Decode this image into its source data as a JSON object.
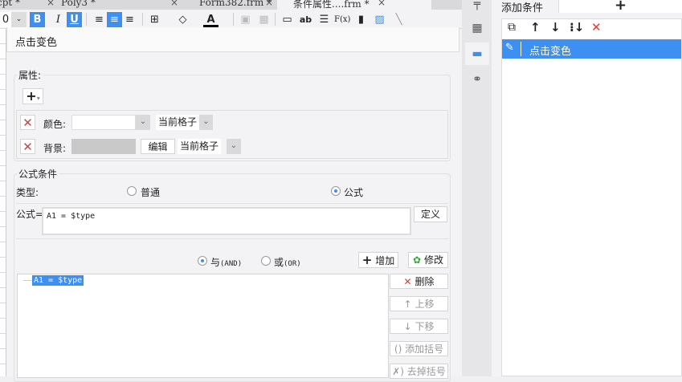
{
  "tabs": [
    {
      "label": "cpt *"
    },
    {
      "label": "Poly3 *"
    },
    {
      "label": "Form382.frm *"
    },
    {
      "label": "条件属性....frm *"
    }
  ],
  "toolbar": {
    "font_size": "0",
    "bold": "B",
    "italic": "I",
    "underline": "U",
    "formula": "F(x)",
    "text_ab": "ab",
    "font_color": "A"
  },
  "dialog": {
    "name": "点击变色",
    "attributes": {
      "legend": "属性:",
      "add": "+",
      "rows": [
        {
          "label": "颜色:",
          "value": "",
          "scope": "当前格子"
        },
        {
          "label": "背景:",
          "edit": "编辑",
          "scope": "当前格子"
        }
      ]
    },
    "formula_cond": {
      "legend": "公式条件",
      "type_label": "类型:",
      "opt_normal": "普通",
      "opt_formula": "公式",
      "formula_label": "公式=",
      "formula_value": "A1 = $type",
      "define": "定义",
      "and_label": "与",
      "and_sub": "(AND)",
      "or_label": "或",
      "or_sub": "(OR)",
      "add": "增加",
      "modify": "修改",
      "conditions": [
        "A1 = $type"
      ],
      "side_buttons": [
        "删除",
        "上移",
        "下移",
        "添加括号",
        "去掉括号"
      ]
    }
  },
  "right_panel": {
    "tab": "添加条件",
    "add": "+",
    "items": [
      {
        "label": "点击变色",
        "selected": true
      }
    ]
  },
  "colors": {
    "accent": "#3d8ff2",
    "delete": "#e53935"
  }
}
